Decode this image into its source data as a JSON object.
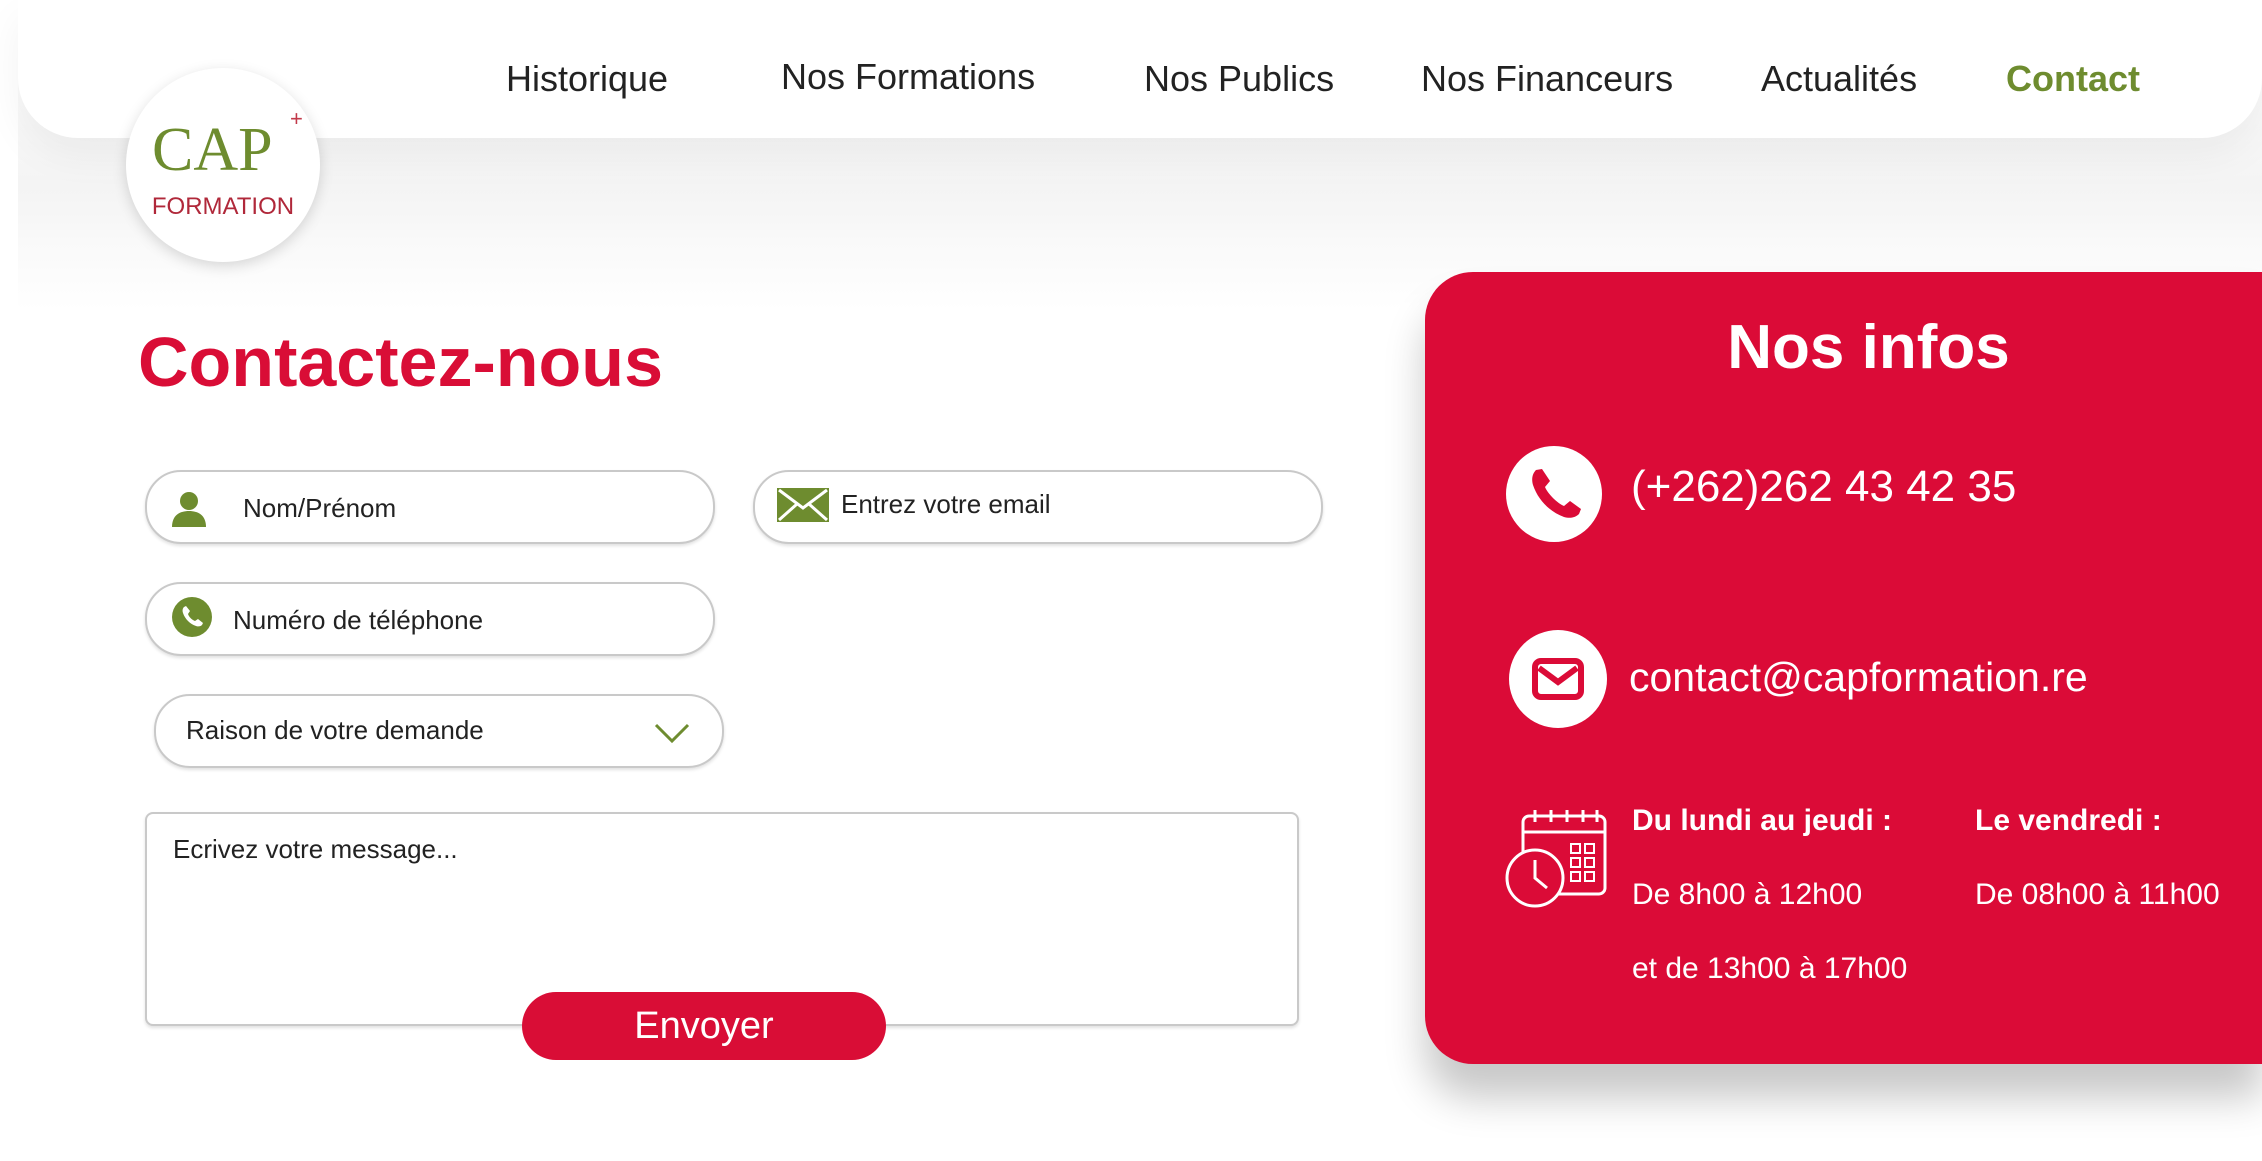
{
  "nav": {
    "items": [
      "Historique",
      "Nos Formations",
      "Nos Publics",
      "Nos Financeurs",
      "Actualités",
      "Contact"
    ],
    "active": "Contact",
    "active_color": "#6e8c2f"
  },
  "logo": {
    "text_cap": "CAP",
    "text_formation": "FORMATION",
    "plus": "+"
  },
  "page": {
    "title": "Contactez-nous",
    "title_color": "#d90d36"
  },
  "form": {
    "name_placeholder": "Nom/Prénom",
    "email_placeholder": "Entrez votre email",
    "phone_placeholder": "Numéro de téléphone",
    "reason_placeholder": "Raison de votre demande",
    "message_placeholder": "Ecrivez votre message...",
    "submit_label": "Envoyer",
    "icons": [
      "user-icon",
      "envelope-icon",
      "phone-icon",
      "chevron-down-icon"
    ]
  },
  "info": {
    "title": "Nos infos",
    "phone": "(+262)262 43 42 35",
    "email": "contact@capformation.re",
    "card_color": "#db0b37",
    "hours": {
      "weekdays_label": "Du lundi au jeudi :",
      "weekdays_morning": "De 8h00 à 12h00",
      "weekdays_afternoon": "et de 13h00 à 17h00",
      "friday_label": "Le vendredi :",
      "friday_hours": "De 08h00 à 11h00"
    },
    "icons": [
      "phone-icon",
      "mail-icon",
      "calendar-clock-icon"
    ]
  }
}
